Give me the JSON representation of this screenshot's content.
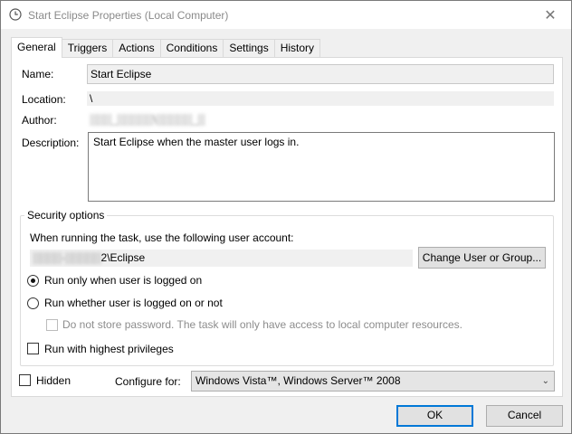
{
  "window": {
    "title": "Start Eclipse Properties (Local Computer)"
  },
  "tabs": [
    {
      "label": "General"
    },
    {
      "label": "Triggers"
    },
    {
      "label": "Actions"
    },
    {
      "label": "Conditions"
    },
    {
      "label": "Settings"
    },
    {
      "label": "History"
    }
  ],
  "general": {
    "name_label": "Name:",
    "name_value": "Start Eclipse",
    "location_label": "Location:",
    "location_value": "\\",
    "author_label": "Author:",
    "author_value": "▒▒▒_▒▒▒▒▒\\▒▒▒▒▒_▒",
    "description_label": "Description:",
    "description_value": "Start Eclipse when the master user logs in."
  },
  "security": {
    "group_title": "Security options",
    "account_prompt": "When running the task, use the following user account:",
    "account_prefix": "▒▒▒▒-▒▒▒▒▒",
    "account_suffix": "2\\Eclipse",
    "change_button": "Change User or Group...",
    "radio_logged_on": "Run only when user is logged on",
    "radio_whether": "Run whether user is logged on or not",
    "no_store_password": "Do not store password.  The task will only have access to local computer resources.",
    "highest_privileges": "Run with highest privileges"
  },
  "footer": {
    "hidden_label": "Hidden",
    "configure_label": "Configure for:",
    "configure_value": "Windows Vista™, Windows Server™ 2008"
  },
  "buttons": {
    "ok": "OK",
    "cancel": "Cancel"
  }
}
